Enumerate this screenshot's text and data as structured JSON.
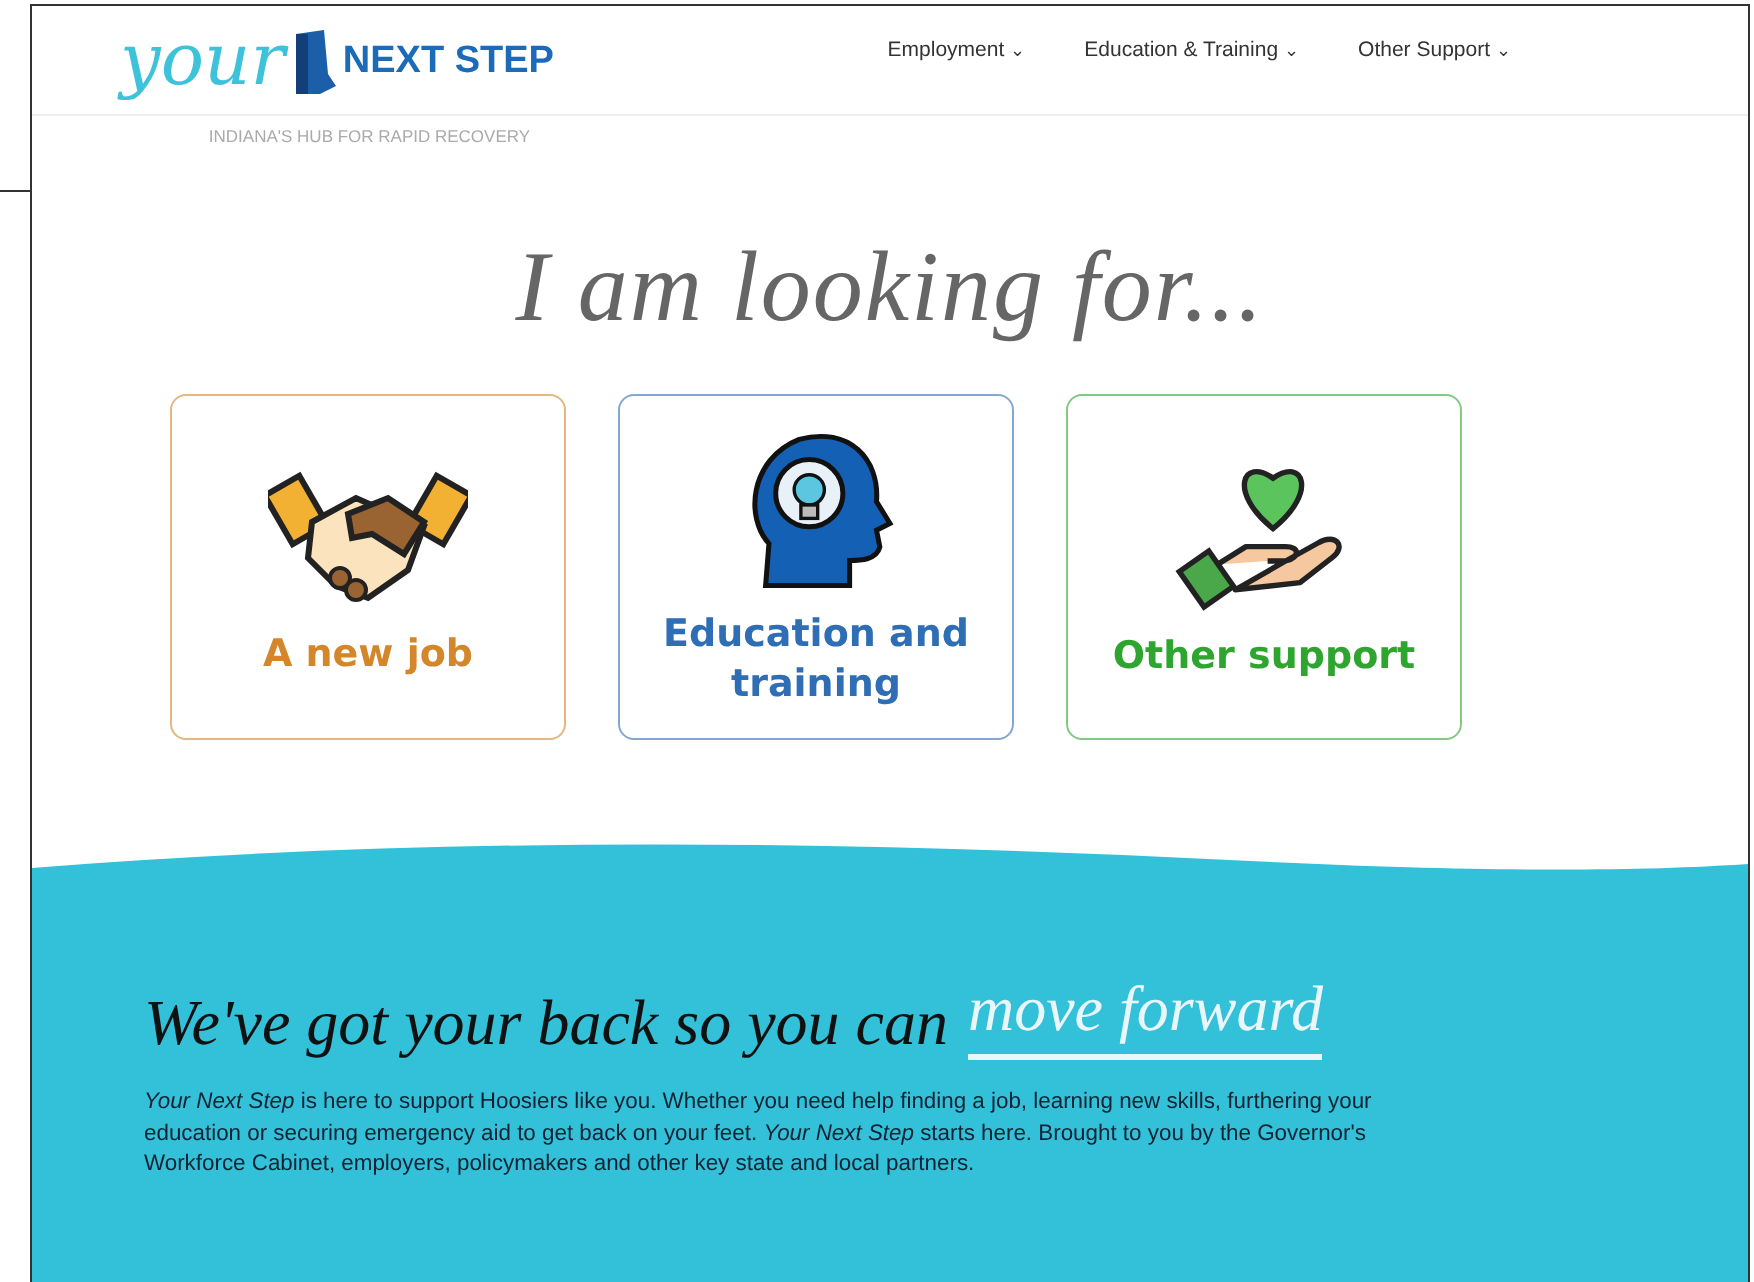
{
  "logo": {
    "script": "your",
    "wordmark": "NEXT STEP",
    "tagline": "INDIANA'S HUB FOR RAPID RECOVERY"
  },
  "nav": [
    {
      "label": "Employment",
      "caret": "⌄"
    },
    {
      "label": "Education & Training",
      "caret": "⌄"
    },
    {
      "label": "Other Support",
      "caret": "⌄"
    }
  ],
  "heading": "I am looking for...",
  "cards": [
    {
      "kind": "job",
      "label": "A new job",
      "color": "#d4862a"
    },
    {
      "kind": "education",
      "label": "Education and training",
      "color": "#2f6db5"
    },
    {
      "kind": "support",
      "label": "Other support",
      "color": "#2ea52e"
    }
  ],
  "hero": {
    "lead": "We've got your back so you can",
    "highlight": "move forward"
  },
  "intro": "*Your Next Step* is here to support Hoosiers like you. Whether you need help finding a job, learning new skills, furthering your education or securing emergency aid to get back on your feet. *Your Next Step* starts here. Brought to you by the Governor's Workforce Cabinet, employers, policymakers and other key state and local partners."
}
